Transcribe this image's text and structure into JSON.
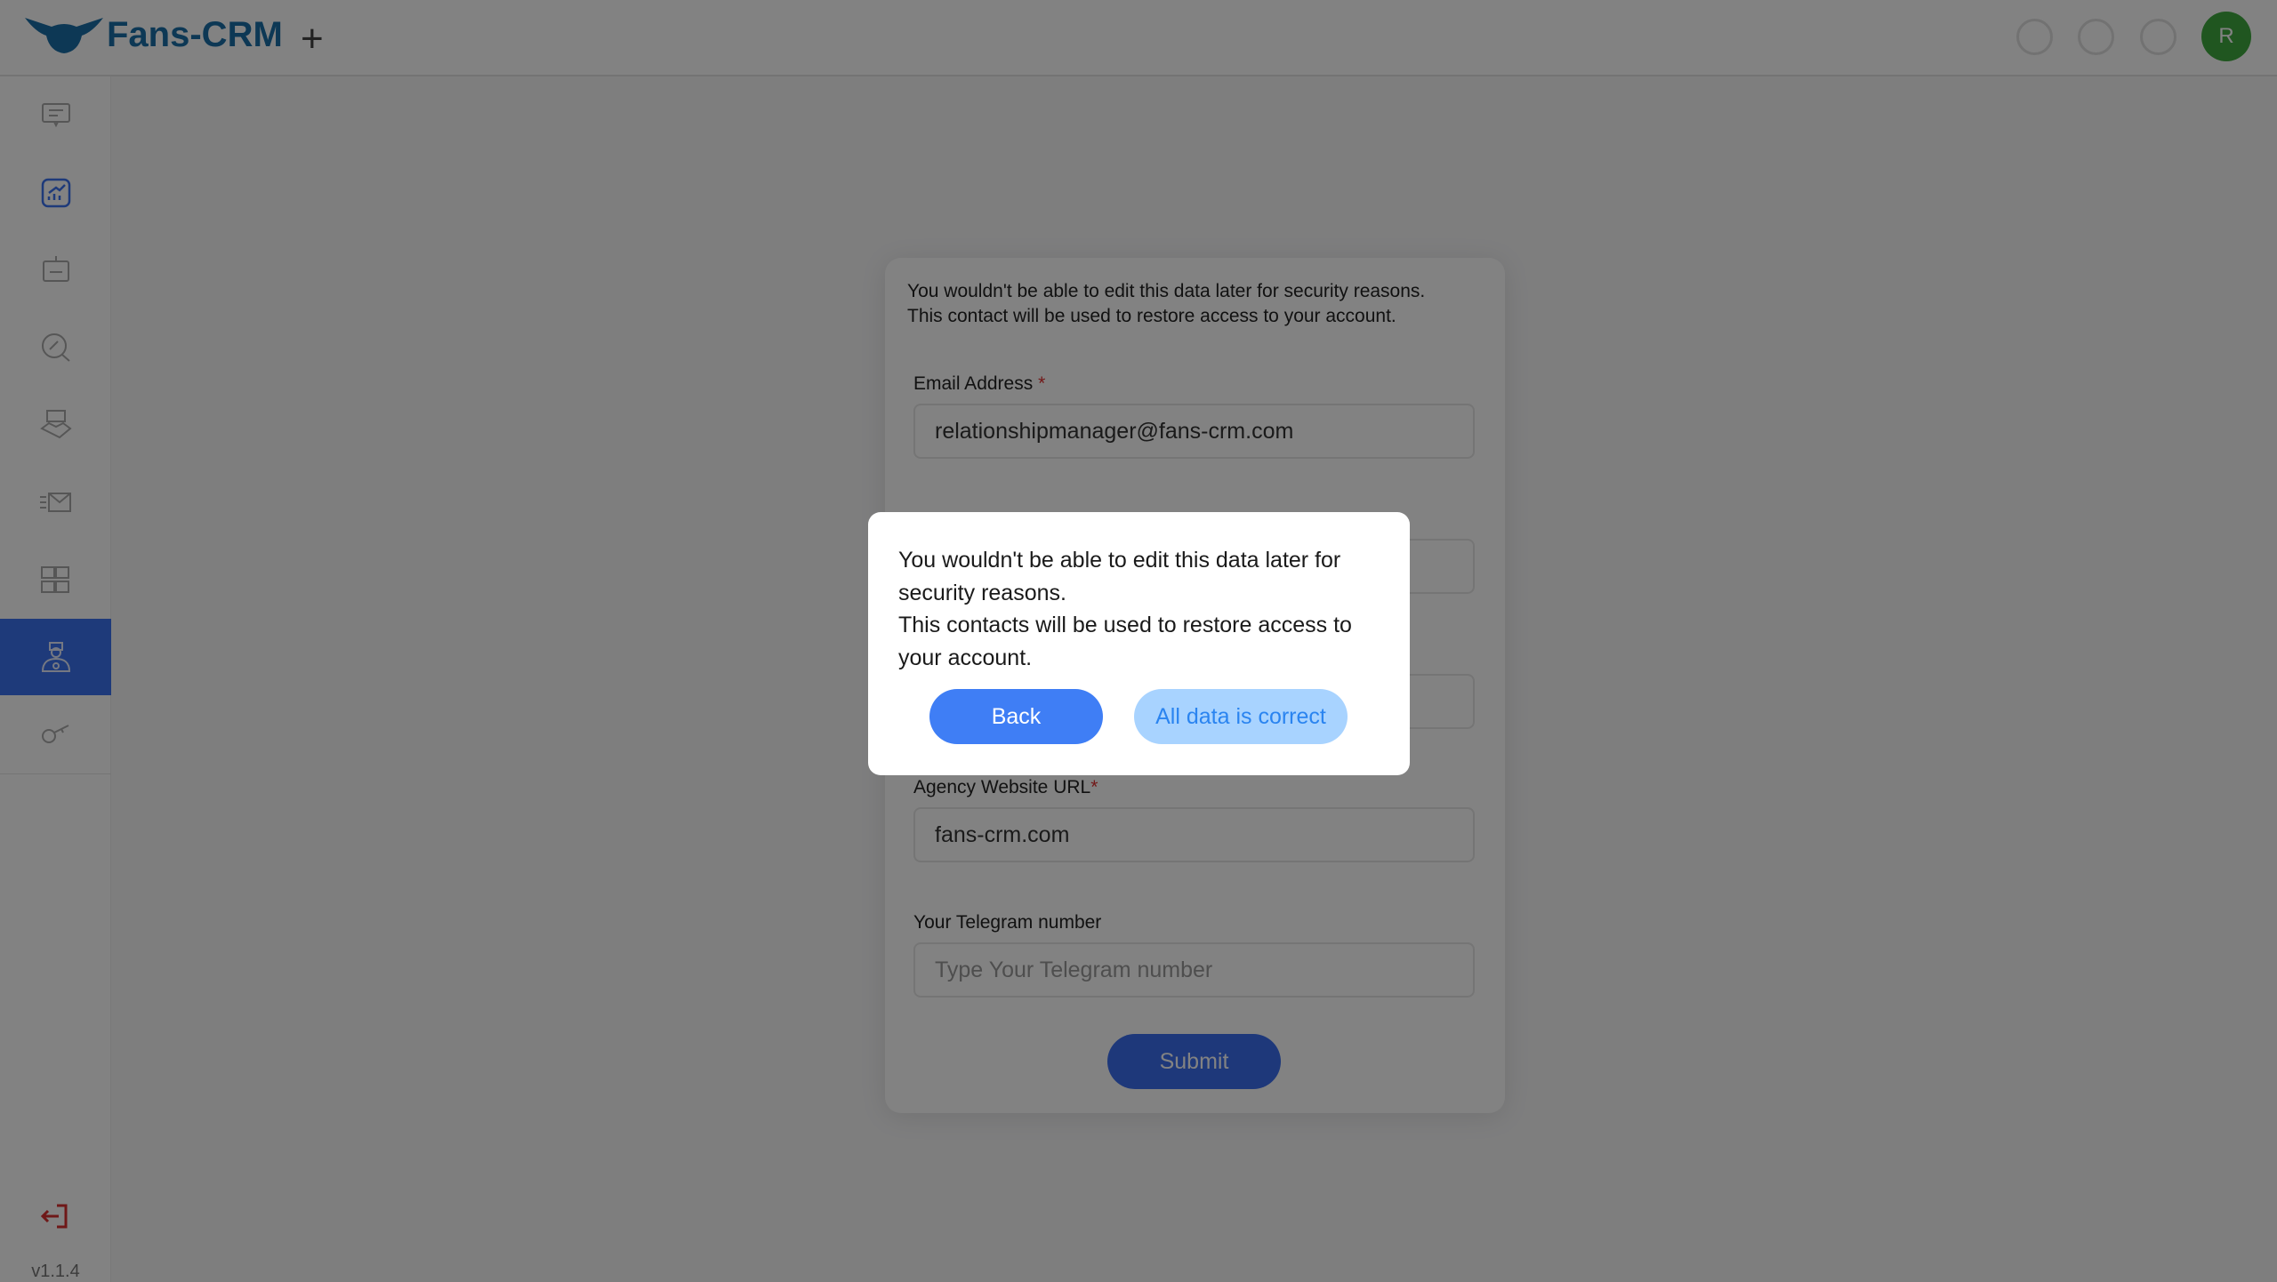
{
  "header": {
    "logo_text": "Fans-CRM",
    "add_label": "+",
    "avatar_initial": "R",
    "brand_color": "#1a6ea8",
    "avatar_color": "#3faa3f"
  },
  "sidebar": {
    "items": [
      {
        "icon": "chat-icon"
      },
      {
        "icon": "analytics-icon"
      },
      {
        "icon": "bot-icon"
      },
      {
        "icon": "link-search-icon"
      },
      {
        "icon": "handshake-icon"
      },
      {
        "icon": "mail-send-icon"
      },
      {
        "icon": "sort-blocks-icon"
      },
      {
        "icon": "manager-icon",
        "active": true
      },
      {
        "icon": "key-icon"
      }
    ],
    "logout_icon": "logout-icon",
    "version": "v1.1.4",
    "active_color": "#3b73ef"
  },
  "form": {
    "note_line1": "You wouldn't be able to edit this data later for security reasons.",
    "note_line2": "This contact will be used to restore access to your account.",
    "email_label": "Email Address",
    "email_value": "relationshipmanager@fans-crm.com",
    "website_label": "Agency Website URL",
    "website_value": "fans-crm.com",
    "telegram_label": "Your Telegram number",
    "telegram_placeholder": "Type Your Telegram number",
    "required_mark": "*",
    "submit_label": "Submit"
  },
  "modal": {
    "line1": "You wouldn't be able to edit this data later for security reasons.",
    "line2": "This contacts will be used to restore access to your account.",
    "back_label": "Back",
    "confirm_label": "All data is correct"
  }
}
